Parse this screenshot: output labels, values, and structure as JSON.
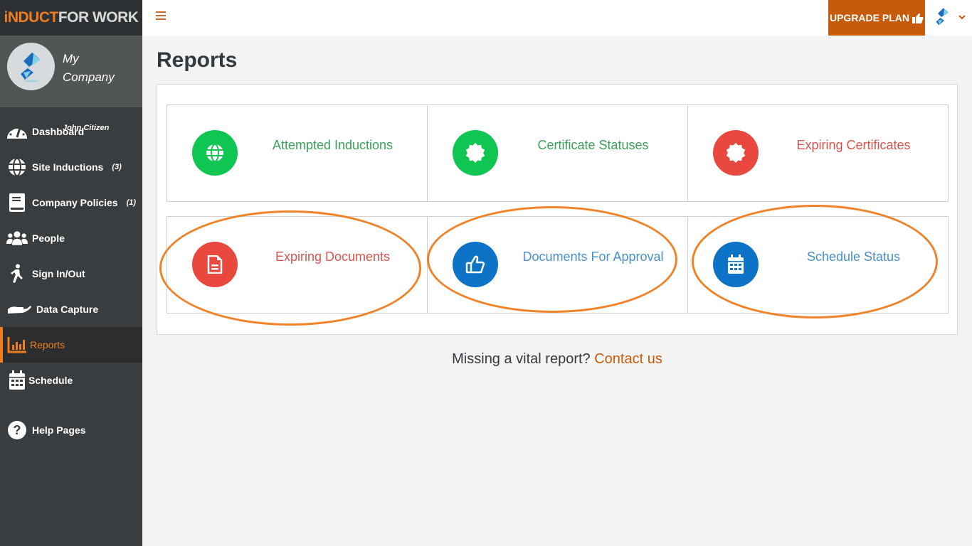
{
  "brand": {
    "part1": "iNDUCT",
    "part2": "FOR WORK"
  },
  "profile": {
    "company": "My Company",
    "user": "John Citizen"
  },
  "sidebar": {
    "items": [
      {
        "label": "Dashboard",
        "icon": "dashboard-gauge-icon",
        "count": ""
      },
      {
        "label": "Site Inductions",
        "icon": "globe-icon",
        "count": "(3)"
      },
      {
        "label": "Company Policies",
        "icon": "book-icon",
        "count": "(1)"
      },
      {
        "label": "People",
        "icon": "people-icon",
        "count": ""
      },
      {
        "label": "Sign In/Out",
        "icon": "walking-person-icon",
        "count": ""
      },
      {
        "label": "Data Capture",
        "icon": "hand-icon",
        "count": ""
      },
      {
        "label": "Reports",
        "icon": "bar-chart-icon",
        "count": "",
        "active": true
      },
      {
        "label": "Schedule",
        "icon": "calendar-icon",
        "count": ""
      },
      {
        "label": "Help Pages",
        "icon": "question-circle-icon",
        "count": ""
      }
    ]
  },
  "topbar": {
    "menu_icon": "hamburger-icon",
    "upgrade_label": "UPGRADE PLAN",
    "upgrade_icon": "thumbs-up-icon",
    "user_icon": "company-logo-icon",
    "dropdown_icon": "chevron-down-icon"
  },
  "page": {
    "title": "Reports"
  },
  "colors": {
    "accent": "#f07e1e",
    "upgrade": "#c75b0c",
    "green": "#0fc653",
    "red": "#e8483d",
    "blue": "#0c73c6",
    "green_text": "#3aa05a",
    "red_text": "#d9534f",
    "blue_text": "#4a90c8",
    "annotation": "#f08227"
  },
  "tiles": [
    {
      "label": "Attempted Inductions",
      "icon": "globe-icon",
      "color": "green",
      "highlighted": false
    },
    {
      "label": "Certificate Statuses",
      "icon": "certificate-badge-icon",
      "color": "green",
      "highlighted": false
    },
    {
      "label": "Expiring Certificates",
      "icon": "certificate-badge-icon",
      "color": "red",
      "highlighted": false
    },
    {
      "label": "Expiring Documents",
      "icon": "document-icon",
      "color": "red",
      "highlighted": true
    },
    {
      "label": "Documents For Approval",
      "icon": "thumbs-up-icon",
      "color": "blue",
      "highlighted": true
    },
    {
      "label": "Schedule Status",
      "icon": "calendar-icon",
      "color": "blue",
      "highlighted": true
    }
  ],
  "footer": {
    "text": "Missing a vital report?",
    "link": "Contact us"
  }
}
